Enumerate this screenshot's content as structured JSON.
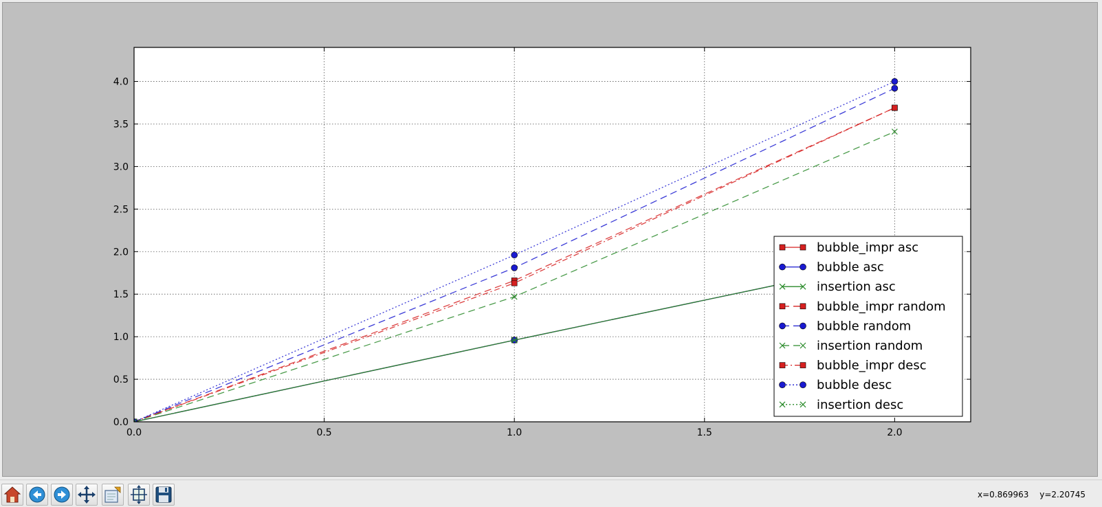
{
  "chart_data": {
    "type": "line",
    "title": "",
    "xlabel": "",
    "ylabel": "",
    "xlim": [
      0,
      2.2
    ],
    "ylim": [
      0,
      4.4
    ],
    "grid": true,
    "xticks": [
      "0.0",
      "0.5",
      "1.0",
      "1.5",
      "2.0"
    ],
    "yticks": [
      "0.0",
      "0.5",
      "1.0",
      "1.5",
      "2.0",
      "2.5",
      "3.0",
      "3.5",
      "4.0"
    ],
    "legend_position": "lower-right",
    "x": [
      0,
      1,
      2
    ],
    "series": [
      {
        "name": "bubble_impr asc",
        "values": [
          0,
          0.96,
          1.9
        ],
        "color": "#d62020",
        "marker": "square",
        "linestyle": "solid"
      },
      {
        "name": "bubble asc",
        "values": [
          0,
          0.96,
          1.9
        ],
        "color": "#1a1ad0",
        "marker": "circle",
        "linestyle": "solid"
      },
      {
        "name": "insertion asc",
        "values": [
          0,
          0.96,
          1.9
        ],
        "color": "#2a8a2a",
        "marker": "x",
        "linestyle": "solid"
      },
      {
        "name": "bubble_impr random",
        "values": [
          0,
          1.66,
          3.69
        ],
        "color": "#d62020",
        "marker": "square",
        "linestyle": "dashed"
      },
      {
        "name": "bubble random",
        "values": [
          0,
          1.81,
          3.92
        ],
        "color": "#1a1ad0",
        "marker": "circle",
        "linestyle": "dashed"
      },
      {
        "name": "insertion random",
        "values": [
          0,
          1.47,
          3.41
        ],
        "color": "#2a8a2a",
        "marker": "x",
        "linestyle": "dashed"
      },
      {
        "name": "bubble_impr desc",
        "values": [
          0,
          1.63,
          3.69
        ],
        "color": "#d62020",
        "marker": "square",
        "linestyle": "dashdot"
      },
      {
        "name": "bubble desc",
        "values": [
          0,
          1.96,
          4.0
        ],
        "color": "#1a1ad0",
        "marker": "circle",
        "linestyle": "dotted"
      },
      {
        "name": "insertion desc",
        "values": [
          0,
          0.96,
          1.9
        ],
        "color": "#2a8a2a",
        "marker": "x",
        "linestyle": "dotted"
      }
    ]
  },
  "toolbar": {
    "buttons": [
      {
        "name": "home-button",
        "icon": "home-icon"
      },
      {
        "name": "back-button",
        "icon": "back-arrow-icon"
      },
      {
        "name": "forward-button",
        "icon": "forward-arrow-icon"
      },
      {
        "name": "pan-button",
        "icon": "move-icon"
      },
      {
        "name": "zoom-button",
        "icon": "zoom-rect-icon"
      },
      {
        "name": "subplots-button",
        "icon": "subplots-icon"
      },
      {
        "name": "save-button",
        "icon": "floppy-disk-icon"
      }
    ]
  },
  "status": {
    "x_readout": "x=0.869963",
    "y_readout": "y=2.20745"
  }
}
